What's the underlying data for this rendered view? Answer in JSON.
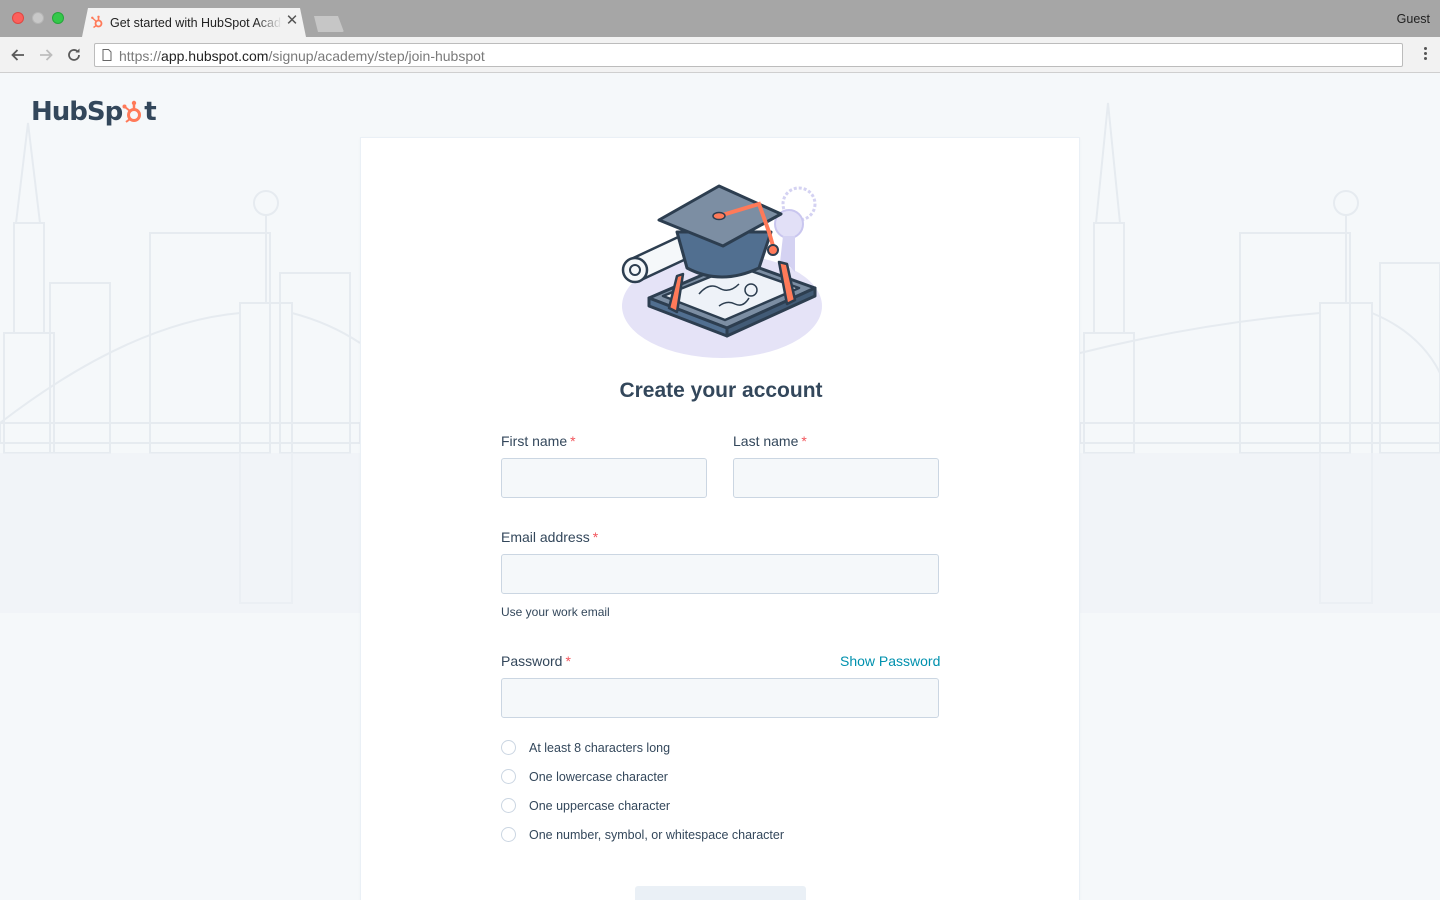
{
  "browser": {
    "tab_title": "Get started with HubSpot Academy",
    "profile": "Guest",
    "url_scheme": "https://",
    "url_host": "app.hubspot.com",
    "url_path": "/signup/academy/step/join-hubspot"
  },
  "colors": {
    "accent_link": "#0091ae",
    "required_star": "#f2545b",
    "heading_text": "#33475b",
    "brand_orange": "#ff7a59"
  },
  "logo": {
    "text_before": "HubSp",
    "text_after": "t"
  },
  "form": {
    "heading": "Create your account",
    "first_name_label": "First name",
    "last_name_label": "Last name",
    "email_label": "Email address",
    "email_help": "Use your work email",
    "password_label": "Password",
    "show_password": "Show Password",
    "required_mark": "*",
    "first_name_value": "",
    "last_name_value": "",
    "email_value": "",
    "password_value": "",
    "rules": [
      "At least 8 characters long",
      "One lowercase character",
      "One uppercase character",
      "One number, symbol, or whitespace character"
    ]
  }
}
